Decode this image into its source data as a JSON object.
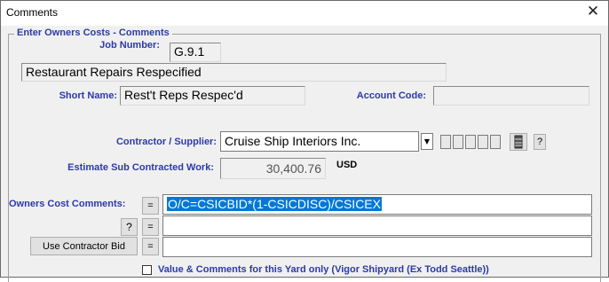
{
  "window": {
    "title": "Comments",
    "close_glyph": "✕"
  },
  "group": {
    "legend": "Enter Owners Costs  - Comments"
  },
  "job": {
    "label": "Job Number:",
    "value": "G.9.1",
    "description": "Restaurant Repairs Respecified"
  },
  "short_name": {
    "label": "Short Name:",
    "value": "Rest't Reps Respec'd"
  },
  "account_code": {
    "label": "Account Code:",
    "value": ""
  },
  "contractor": {
    "label": "Contractor / Supplier:",
    "value": "Cruise Ship Interiors Inc.",
    "help_label": "?"
  },
  "estimate": {
    "label": "Estimate Sub Contracted Work:",
    "value": "30,400.76",
    "currency": "USD"
  },
  "owners_cost": {
    "label": "Owners Cost Comments:",
    "eq_label": "=",
    "line1": "O/C=CSICBID*(1-CSICDISC)/CSICEX",
    "line2": "",
    "line3": "",
    "help_label": "?",
    "use_bid_label": "Use Contractor Bid"
  },
  "yard_only": {
    "label": "Value & Comments for this Yard only (Vigor Shipyard (Ex Todd Seattle))",
    "checked": false
  },
  "colors": {
    "label_blue": "#2b3aa8",
    "selection": "#0078d7"
  }
}
